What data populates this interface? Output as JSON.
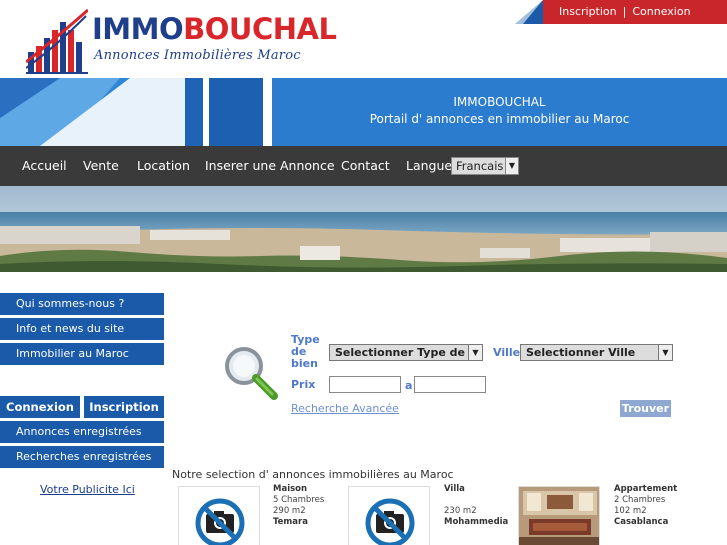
{
  "header": {
    "logo_title_part1": "IMMO",
    "logo_title_part2": "BOUCHAL",
    "logo_subtitle": "Annonces Immobilières Maroc",
    "topbar_links": [
      "Inscription",
      "Connexion"
    ],
    "topbar_separator": "|"
  },
  "banner": {
    "title": "IMMOBOUCHAL",
    "subtitle": "Portail d' annonces en immobilier au Maroc"
  },
  "nav": {
    "items": [
      "Accueil",
      "Vente",
      "Location",
      "Inserer une Annonce",
      "Contact"
    ],
    "language_label": "Langue",
    "language_value": "Francais"
  },
  "sidebar": {
    "info_links": [
      "Qui sommes-nous ?",
      "Info et news du site",
      "Immobilier au Maroc"
    ],
    "connexion_label": "Connexion",
    "inscription_label": "Inscription",
    "account_links": [
      "Annonces enregistrées",
      "Recherches enregistrées"
    ],
    "pub_link": "Votre Publicite Ici"
  },
  "search": {
    "type_label_lines": [
      "Type",
      "de",
      "bien"
    ],
    "type_value": "Selectionner Type de bien",
    "ville_label": "Ville",
    "ville_value": "Selectionner Ville",
    "prix_label": "Prix",
    "prix_separator": "a",
    "prix_min": "",
    "prix_max": "",
    "advanced_link": "Recherche Avancée",
    "submit_label": "Trouver"
  },
  "selection": {
    "title": "Notre selection d' annonces immobilières au Maroc",
    "listings": [
      {
        "type": "Maison",
        "rooms": "5 Chambres",
        "area": "290 m2",
        "city": "Temara",
        "photo": "no-photo-icon"
      },
      {
        "type": "Villa",
        "rooms": "",
        "area": "230 m2",
        "city": "Mohammedia",
        "photo": "no-photo-icon"
      },
      {
        "type": "Appartement",
        "rooms": "2 Chambres",
        "area": "102 m2",
        "city": "Casablanca",
        "photo": "interior-photo"
      }
    ]
  },
  "colors": {
    "brand_blue": "#1a5aa8",
    "brand_red": "#c8262b",
    "nav_bg": "#3a3a3a",
    "banner_blue": "#2b7bce",
    "label_blue": "#4f79c7"
  }
}
